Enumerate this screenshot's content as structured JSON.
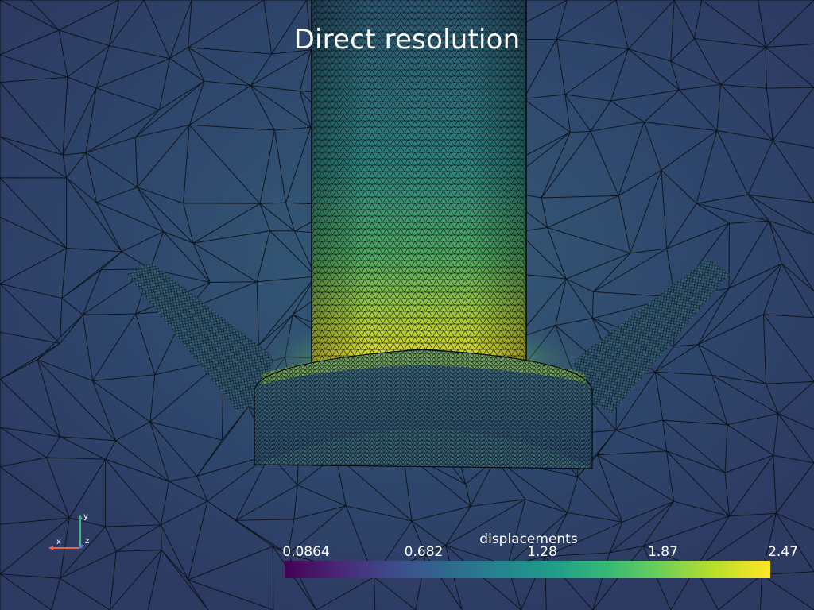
{
  "viewer": {
    "title": "Direct resolution",
    "background_color": "#2d3b63"
  },
  "scalar_bar": {
    "title": "displacements",
    "ticks": [
      "0.0864",
      "0.682",
      "1.28",
      "1.87",
      "2.47"
    ],
    "colormap": "viridis"
  },
  "orientation_axes": {
    "x_label": "x",
    "y_label": "y",
    "z_label": "z",
    "x_color": "#e8674a",
    "y_color": "#3dba7d",
    "z_color": "#4a7ee8"
  }
}
